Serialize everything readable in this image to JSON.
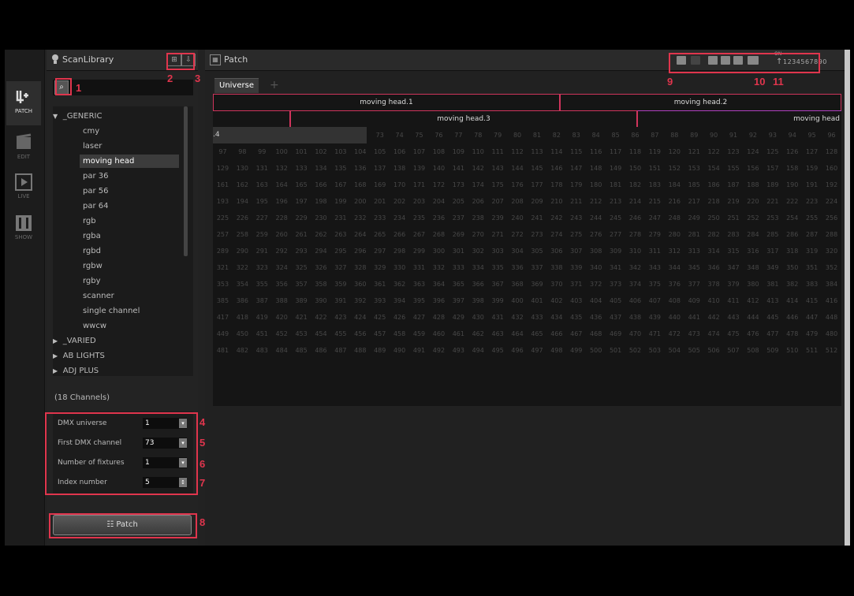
{
  "nav": [
    {
      "id": "patch",
      "label": "PATCH",
      "icon": "patch-icon"
    },
    {
      "id": "edit",
      "label": "EDIT",
      "icon": "edit-icon"
    },
    {
      "id": "live",
      "label": "LIVE",
      "icon": "play-icon"
    },
    {
      "id": "show",
      "label": "SHOW",
      "icon": "show-icon"
    }
  ],
  "library": {
    "title": "ScanLibrary",
    "tree": [
      {
        "label": "_GENERIC",
        "kind": "folder",
        "open": true
      },
      {
        "label": "cmy",
        "kind": "leaf"
      },
      {
        "label": "laser",
        "kind": "leaf"
      },
      {
        "label": "moving head",
        "kind": "leaf",
        "selected": true
      },
      {
        "label": "par 36",
        "kind": "leaf"
      },
      {
        "label": "par 56",
        "kind": "leaf"
      },
      {
        "label": "par 64",
        "kind": "leaf"
      },
      {
        "label": "rgb",
        "kind": "leaf"
      },
      {
        "label": "rgba",
        "kind": "leaf"
      },
      {
        "label": "rgbd",
        "kind": "leaf"
      },
      {
        "label": "rgbw",
        "kind": "leaf"
      },
      {
        "label": "rgby",
        "kind": "leaf"
      },
      {
        "label": "scanner",
        "kind": "leaf"
      },
      {
        "label": "single channel",
        "kind": "leaf"
      },
      {
        "label": "wwcw",
        "kind": "leaf"
      },
      {
        "label": "_VARIED",
        "kind": "folder",
        "open": false
      },
      {
        "label": "AB LIGHTS",
        "kind": "folder",
        "open": false
      },
      {
        "label": "ADJ PLUS",
        "kind": "folder",
        "open": false
      }
    ],
    "channels": "(18 Channels)",
    "form": {
      "dmx_universe_label": "DMX universe",
      "dmx_universe": "1",
      "first_channel_label": "First DMX channel",
      "first_channel": "73",
      "fixtures_label": "Number of fixtures",
      "fixtures": "1",
      "index_label": "Index number",
      "index": "5"
    },
    "patch_button": "Patch"
  },
  "patch": {
    "title": "Patch",
    "tab": "Universe 1",
    "fixtures_row1": [
      "moving head.1",
      "moving head.2"
    ],
    "fixtures_row2": [
      "moving head.3",
      "moving head"
    ],
    "partial_cell": ".4",
    "dmx_indicator": "1234567890",
    "dmx_on_label": "ON"
  },
  "annotations": [
    "1",
    "2",
    "3",
    "4",
    "5",
    "6",
    "7",
    "8",
    "9",
    "10",
    "11"
  ],
  "colors": {
    "accent": "#e0354d",
    "fixture_border": "#d0345c",
    "selected": "#3c3c3c"
  }
}
